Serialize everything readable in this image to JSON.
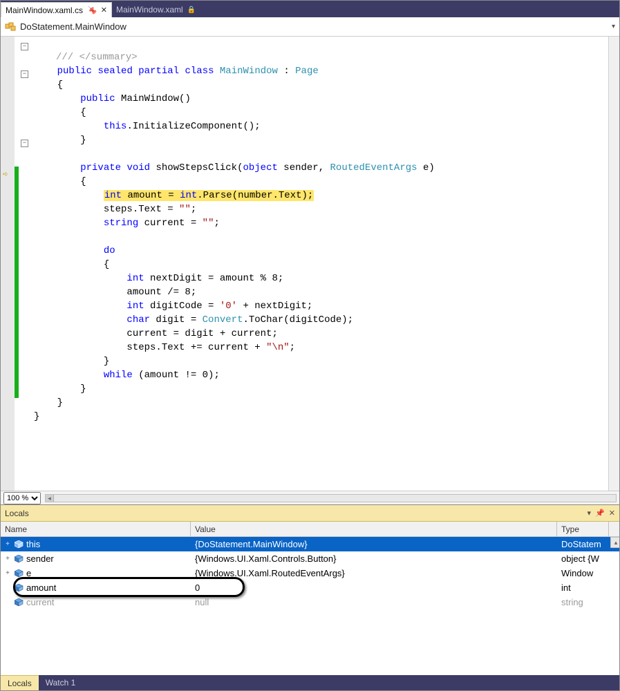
{
  "tabs": {
    "active": "MainWindow.xaml.cs",
    "inactive": "MainWindow.xaml"
  },
  "classbar": {
    "name": "DoStatement.MainWindow"
  },
  "zoom": "100 %",
  "code": {
    "faded_top": "/// </summary>",
    "l1a": "public",
    "l1b": "sealed",
    "l1c": "partial",
    "l1d": "class",
    "l1e": "MainWindow",
    "l1f": " : ",
    "l1g": "Page",
    "l3a": "public",
    "l3b": " MainWindow()",
    "l5a": "this",
    "l5b": ".InitializeComponent();",
    "l8a": "private",
    "l8b": "void",
    "l8c": " showStepsClick(",
    "l8d": "object",
    "l8e": " sender, ",
    "l8f": "RoutedEventArgs",
    "l8g": " e)",
    "l10a": "int",
    "l10b": " amount = ",
    "l10c": "int",
    "l10d": ".Parse(number.Text);",
    "l11a": "steps.Text = ",
    "l11b": "\"\"",
    "l11c": ";",
    "l12a": "string",
    "l12b": " current = ",
    "l12c": "\"\"",
    "l12d": ";",
    "l14a": "do",
    "l16a": "int",
    "l16b": " nextDigit = amount % 8;",
    "l17a": "amount /= 8;",
    "l18a": "int",
    "l18b": " digitCode = ",
    "l18c": "'0'",
    "l18d": " + nextDigit;",
    "l19a": "char",
    "l19b": " digit = ",
    "l19c": "Convert",
    "l19d": ".ToChar(digitCode);",
    "l20a": "current = digit + current;",
    "l21a": "steps.Text += current + ",
    "l21b": "\"\\n\"",
    "l21c": ";",
    "l23a": "while",
    "l23b": " (amount != 0);"
  },
  "locals": {
    "title": "Locals",
    "head": {
      "name": "Name",
      "value": "Value",
      "type": "Type"
    },
    "rows": [
      {
        "exp": "+",
        "name": "this",
        "value": "{DoStatement.MainWindow}",
        "type": "DoStatem",
        "sel": true,
        "faded": false
      },
      {
        "exp": "+",
        "name": "sender",
        "value": "{Windows.UI.Xaml.Controls.Button}",
        "type": "object {W",
        "sel": false,
        "faded": false
      },
      {
        "exp": "+",
        "name": "e",
        "value": "{Windows.UI.Xaml.RoutedEventArgs}",
        "type": "Window",
        "sel": false,
        "faded": false
      },
      {
        "exp": "",
        "name": "amount",
        "value": "0",
        "type": "int",
        "sel": false,
        "faded": false
      },
      {
        "exp": "",
        "name": "current",
        "value": "null",
        "type": "string",
        "sel": false,
        "faded": true
      }
    ]
  },
  "bottomtabs": {
    "active": "Locals",
    "other": "Watch 1"
  }
}
